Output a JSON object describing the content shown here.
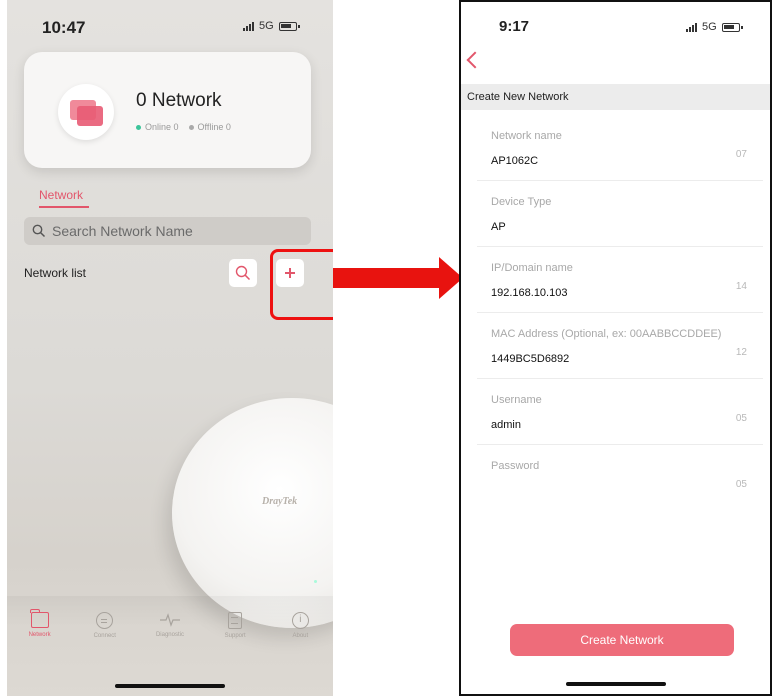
{
  "left_screen": {
    "status_bar": {
      "time": "10:47",
      "network": "5G"
    },
    "summary": {
      "count_label": "0 Network",
      "online_label": "Online 0",
      "offline_label": "Offline 0"
    },
    "tab": {
      "label": "Network"
    },
    "search": {
      "placeholder": "Search Network Name"
    },
    "list": {
      "title": "Network list"
    },
    "device_brand": "DrayTek",
    "bottom_nav": [
      {
        "label": "Network",
        "icon": "folder-icon"
      },
      {
        "label": "Connect",
        "icon": "connect-icon"
      },
      {
        "label": "Diagnostic",
        "icon": "pulse-icon"
      },
      {
        "label": "Support",
        "icon": "document-icon"
      },
      {
        "label": "About",
        "icon": "info-icon"
      }
    ]
  },
  "right_screen": {
    "status_bar": {
      "time": "9:17",
      "network": "5G"
    },
    "header": "Create New Network",
    "fields": [
      {
        "label": "Network name",
        "value": "AP1062C",
        "count": "07"
      },
      {
        "label": "Device Type",
        "value": "AP",
        "count": ""
      },
      {
        "label": "IP/Domain name",
        "value": "192.168.10.103",
        "count": "14"
      },
      {
        "label": "MAC Address (Optional, ex: 00AABBCCDDEE)",
        "value": "1449BC5D6892",
        "count": "12"
      },
      {
        "label": "Username",
        "value": "admin",
        "count": "05"
      },
      {
        "label": "Password",
        "value": "",
        "count": "05"
      }
    ],
    "submit_label": "Create Network"
  },
  "colors": {
    "accent": "#e2566b",
    "button": "#ee6c7a",
    "highlight": "#e8130f"
  }
}
